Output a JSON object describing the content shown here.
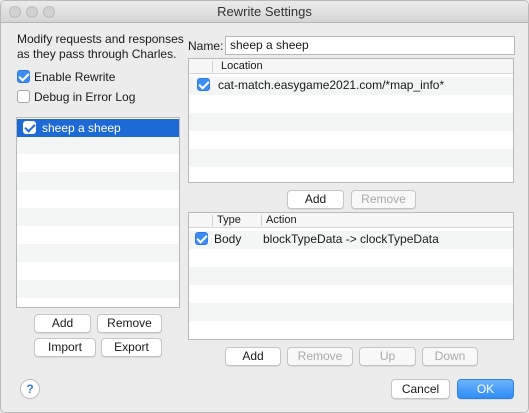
{
  "window": {
    "title": "Rewrite Settings"
  },
  "left": {
    "description_line1": "Modify requests and responses",
    "description_line2": "as they pass through Charles.",
    "enable_rewrite_label": "Enable Rewrite",
    "enable_rewrite_checked": true,
    "debug_label": "Debug in Error Log",
    "debug_checked": false,
    "sets": [
      {
        "label": "sheep a sheep",
        "enabled": true,
        "selected": true
      }
    ],
    "buttons": {
      "add": "Add",
      "remove": "Remove",
      "import": "Import",
      "export": "Export"
    }
  },
  "right": {
    "name_label": "Name:",
    "name_value": "sheep a sheep",
    "locations": {
      "header": "Location",
      "rows": [
        {
          "enabled": true,
          "location": "cat-match.easygame2021.com/*map_info*"
        }
      ],
      "buttons": {
        "add": "Add",
        "remove": "Remove"
      }
    },
    "rules": {
      "header_type": "Type",
      "header_action": "Action",
      "rows": [
        {
          "enabled": true,
          "type": "Body",
          "action": "blockTypeData -> clockTypeData"
        }
      ],
      "buttons": {
        "add": "Add",
        "remove": "Remove",
        "up": "Up",
        "down": "Down"
      }
    }
  },
  "footer": {
    "help_icon": "?",
    "cancel": "Cancel",
    "ok": "OK"
  },
  "colors": {
    "accent": "#1d69d6",
    "checkbox_blue": "#3e8df5",
    "ok_button": "#2f8cf5"
  }
}
